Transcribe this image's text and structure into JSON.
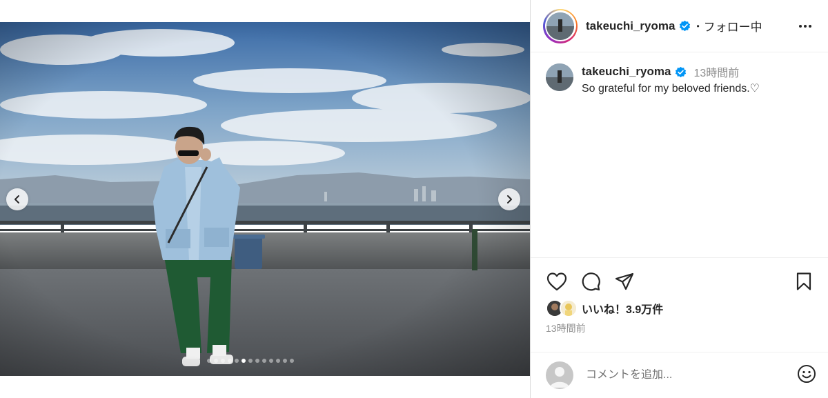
{
  "post": {
    "username": "takeuchi_ryoma",
    "separator": "•",
    "follow_state": "フォロー中",
    "caption": {
      "username": "takeuchi_ryoma",
      "time": "13時間前",
      "text": "So grateful for my beloved friends.♡"
    },
    "likes": "いいね！3.9万件",
    "time": "13時間前",
    "comment_placeholder": "コメントを追加...",
    "carousel": {
      "count": 13,
      "active_index": 5
    }
  },
  "icons": {
    "prev": "chevron-left-icon",
    "next": "chevron-right-icon",
    "more": "more-horizontal-icon",
    "verified": "verified-badge-icon",
    "like": "heart-icon",
    "comment": "comment-icon",
    "share": "send-icon",
    "save": "bookmark-icon",
    "emoji": "emoji-icon"
  },
  "colors": {
    "verified_blue": "#0095f6",
    "text_primary": "#262626",
    "text_secondary": "#8e8e8e"
  }
}
